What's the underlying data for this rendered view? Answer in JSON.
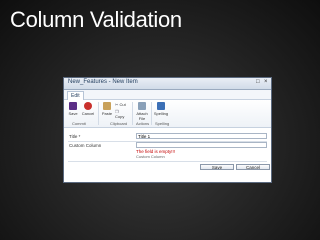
{
  "slide": {
    "title": "Column Validation"
  },
  "dialog": {
    "title": "New_Features - New Item",
    "controls": {
      "maximize": "□",
      "close": "×"
    }
  },
  "ribbon": {
    "tab": "Edit",
    "buttons": {
      "save": "Save",
      "cancel": "Cancel",
      "paste": "Paste",
      "cut": "Cut",
      "copy": "Copy",
      "attach_file": "Attach File",
      "spelling": "Spelling"
    },
    "groups": {
      "commit": "Commit",
      "clipboard": "Clipboard",
      "actions": "Actions",
      "spelling": "Spelling"
    }
  },
  "form": {
    "title_label": "Title *",
    "title_value": "Title 1",
    "custom_label": "Custom Column",
    "error": "The field is empty!!!",
    "custom_hint": "Custom Column",
    "save": "Save",
    "cancel": "Cancel"
  }
}
